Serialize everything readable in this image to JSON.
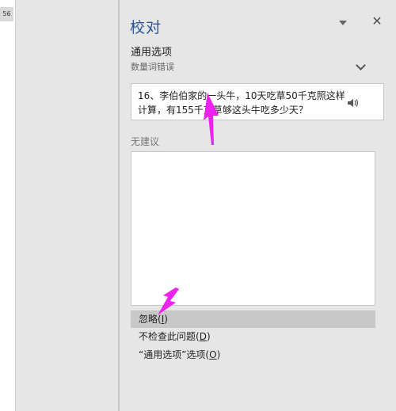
{
  "document": {
    "ruler_number": "56"
  },
  "pane": {
    "title": "校对",
    "section_title": "通用选项",
    "section_subtitle": "数量词错误",
    "sentence_line1": "16、李伯伯家的一头牛，10天吃草50千克照这样",
    "sentence_line2": "计算，有155千克草够这头牛吃多少天？",
    "no_suggestion": "无建议",
    "actions": [
      {
        "label_pre": "忽略(",
        "key": "I",
        "label_post": ")"
      },
      {
        "label_pre": "不检查此问题(",
        "key": "D",
        "label_post": ")"
      },
      {
        "label_pre": "“通用选项”选项(",
        "key": "O",
        "label_post": ")"
      }
    ]
  },
  "colors": {
    "title_blue": "#2b579a",
    "annotation_arrow": "#ee22ee",
    "hover_bg": "#c8c8c8"
  },
  "icons": {
    "menu": "chevron-down-icon",
    "close": "close-icon",
    "collapse": "chevron-down-icon",
    "speaker": "speaker-icon"
  }
}
